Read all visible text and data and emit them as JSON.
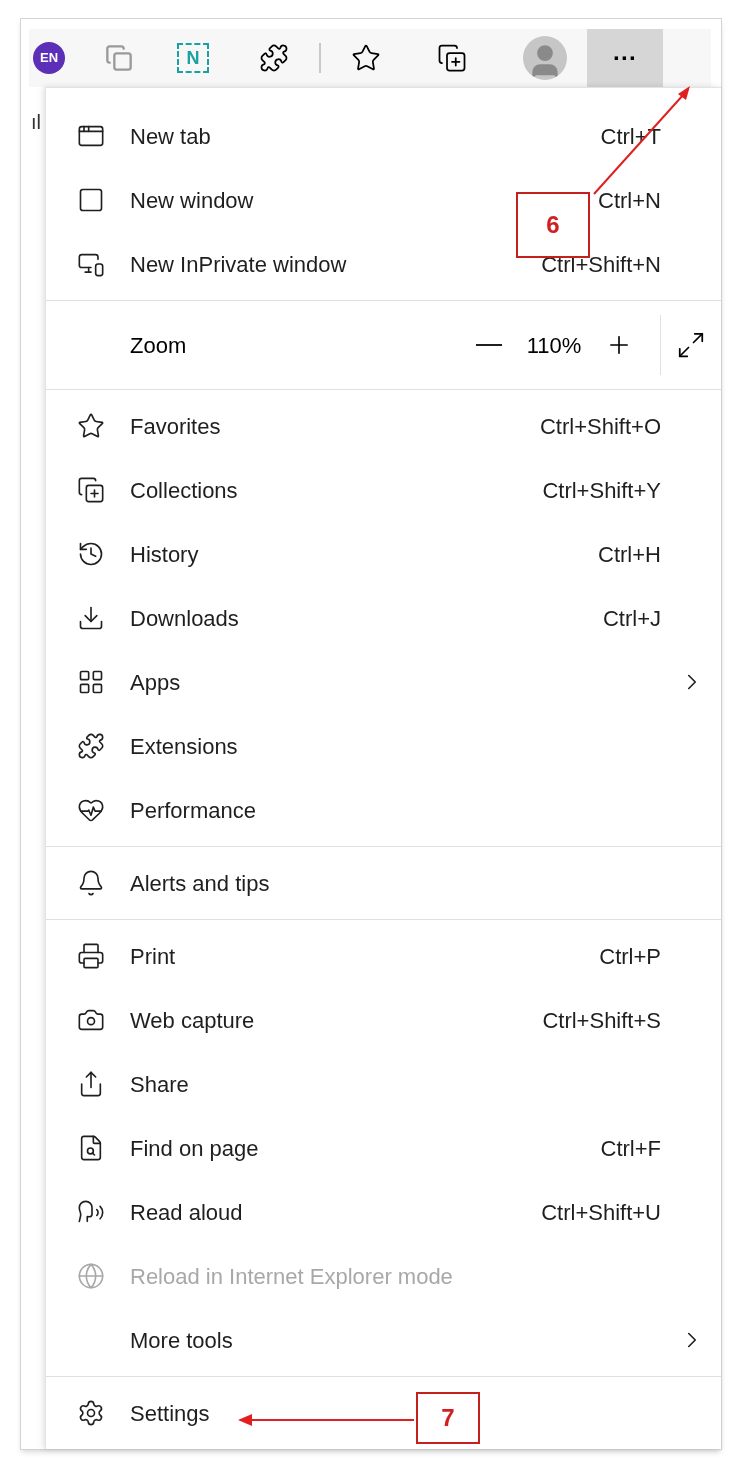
{
  "toolbar": {
    "profile_badge": "EN",
    "notes_badge": "N",
    "more_button": "···"
  },
  "page_fragment": "ıl",
  "menu": {
    "groups": [
      {
        "items": [
          {
            "kind": "item",
            "label": "New tab",
            "shortcut": "Ctrl+T",
            "submenu": false,
            "disabled": false
          },
          {
            "kind": "item",
            "label": "New window",
            "shortcut": "Ctrl+N",
            "submenu": false,
            "disabled": false
          },
          {
            "kind": "item",
            "label": "New InPrivate window",
            "shortcut": "Ctrl+Shift+N",
            "submenu": false,
            "disabled": false
          }
        ]
      },
      {
        "items": [
          {
            "kind": "zoom",
            "label": "Zoom",
            "value": "110%"
          }
        ]
      },
      {
        "items": [
          {
            "kind": "item",
            "label": "Favorites",
            "shortcut": "Ctrl+Shift+O",
            "submenu": false,
            "disabled": false
          },
          {
            "kind": "item",
            "label": "Collections",
            "shortcut": "Ctrl+Shift+Y",
            "submenu": false,
            "disabled": false
          },
          {
            "kind": "item",
            "label": "History",
            "shortcut": "Ctrl+H",
            "submenu": false,
            "disabled": false
          },
          {
            "kind": "item",
            "label": "Downloads",
            "shortcut": "Ctrl+J",
            "submenu": false,
            "disabled": false
          },
          {
            "kind": "item",
            "label": "Apps",
            "submenu": true,
            "disabled": false
          },
          {
            "kind": "item",
            "label": "Extensions",
            "submenu": false,
            "disabled": false
          },
          {
            "kind": "item",
            "label": "Performance",
            "submenu": false,
            "disabled": false
          }
        ]
      },
      {
        "items": [
          {
            "kind": "item",
            "label": "Alerts and tips",
            "submenu": false,
            "disabled": false
          }
        ]
      },
      {
        "items": [
          {
            "kind": "item",
            "label": "Print",
            "shortcut": "Ctrl+P",
            "submenu": false,
            "disabled": false
          },
          {
            "kind": "item",
            "label": "Web capture",
            "shortcut": "Ctrl+Shift+S",
            "submenu": false,
            "disabled": false
          },
          {
            "kind": "item",
            "label": "Share",
            "submenu": false,
            "disabled": false
          },
          {
            "kind": "item",
            "label": "Find on page",
            "shortcut": "Ctrl+F",
            "submenu": false,
            "disabled": false
          },
          {
            "kind": "item",
            "label": "Read aloud",
            "shortcut": "Ctrl+Shift+U",
            "submenu": false,
            "disabled": false
          },
          {
            "kind": "item",
            "label": "Reload in Internet Explorer mode",
            "submenu": false,
            "disabled": true
          },
          {
            "kind": "item",
            "label": "More tools",
            "submenu": true,
            "disabled": false
          }
        ]
      },
      {
        "items": [
          {
            "kind": "item",
            "label": "Settings",
            "submenu": false,
            "disabled": false
          }
        ]
      }
    ]
  },
  "annotations": [
    {
      "label": "6"
    },
    {
      "label": "7"
    }
  ]
}
